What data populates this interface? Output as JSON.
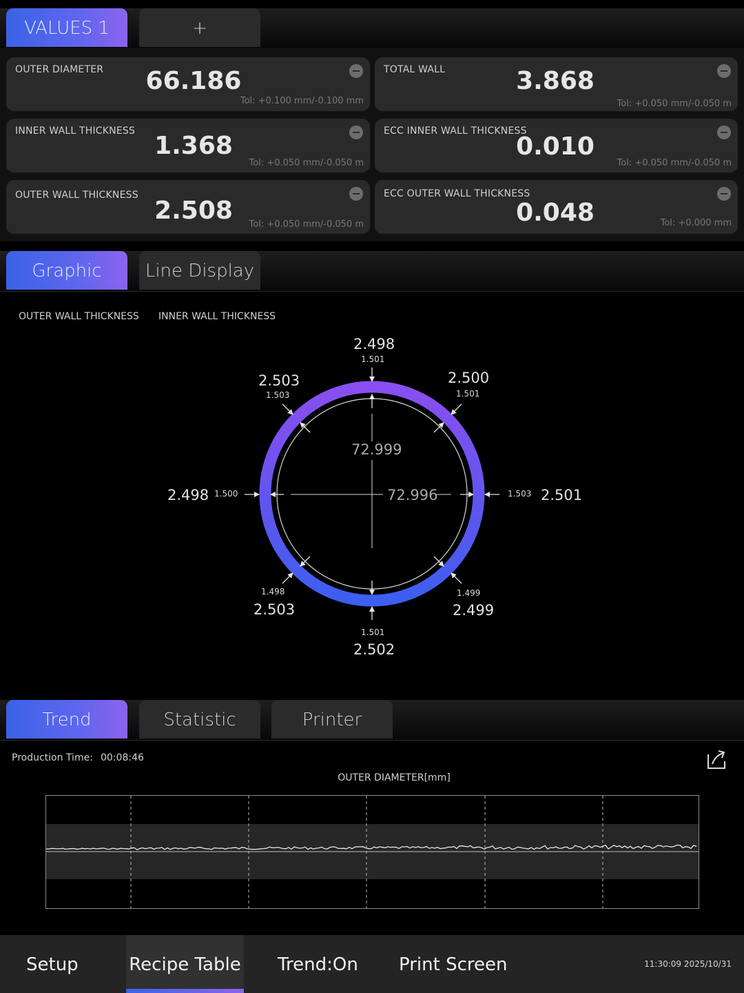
{
  "top_tabs": {
    "values1": "VALUES 1",
    "add": "+"
  },
  "panels": [
    {
      "label": "OUTER DIAMETER",
      "value": "66.186",
      "tol": "Tol: +0.100 mm/-0.100 mm"
    },
    {
      "label": "TOTAL WALL",
      "value": "3.868",
      "tol": "Tol: +0.050 mm/-0.050 m"
    },
    {
      "label": "INNER WALL THICKNESS",
      "value": "1.368",
      "tol": "Tol: +0.050 mm/-0.050 m"
    },
    {
      "label": "ECC INNER WALL THICKNESS",
      "value": "0.010",
      "tol": "Tol: +0.050 mm/-0.050 m"
    },
    {
      "label": "OUTER  WALL THICKNESS",
      "value": "2.508",
      "tol": "Tol: +0.050 mm/-0.050 m"
    },
    {
      "label": "ECC OUTER  WALL THICKNESS",
      "value": "0.048",
      "tol": "Tol: +0.000 mm"
    }
  ],
  "mid_tabs": {
    "graphic": "Graphic",
    "line_display": "Line Display"
  },
  "legend": {
    "outer": "OUTER  WALL THICKNESS",
    "inner": "INNER WALL THICKNESS"
  },
  "ring": {
    "top": {
      "outer": "2.498",
      "inner": "1.501"
    },
    "top_left": {
      "outer": "2.503",
      "inner": "1.503"
    },
    "top_right": {
      "outer": "2.500",
      "inner": "1.501"
    },
    "left": {
      "outer": "2.498",
      "inner": "1.500"
    },
    "right": {
      "outer": "2.501",
      "inner": "1.503"
    },
    "bottom_left": {
      "outer": "2.503",
      "inner": "1.498"
    },
    "bottom_right": {
      "outer": "2.499",
      "inner": "1.499"
    },
    "bottom": {
      "outer": "2.502",
      "inner": "1.501"
    },
    "vertical_diameter": "72.999",
    "horizontal_diameter": "72.996"
  },
  "bottom_tabs": {
    "trend": "Trend",
    "statistic": "Statistic",
    "printer": "Printer"
  },
  "trend": {
    "production_time_label": "Production Time:",
    "production_time": "00:08:46",
    "chart_title": "OUTER DIAMETER[mm]"
  },
  "bottom_bar": {
    "setup": "Setup",
    "recipe_table": "Recipe Table",
    "trend_on": "Trend:On",
    "print_screen": "Print Screen",
    "clock": "11:30:09  2025/10/31"
  },
  "colors": {
    "accent_blue": "#3a63e6",
    "accent_purple": "#8d63ee",
    "panel": "#2a2a2a"
  }
}
